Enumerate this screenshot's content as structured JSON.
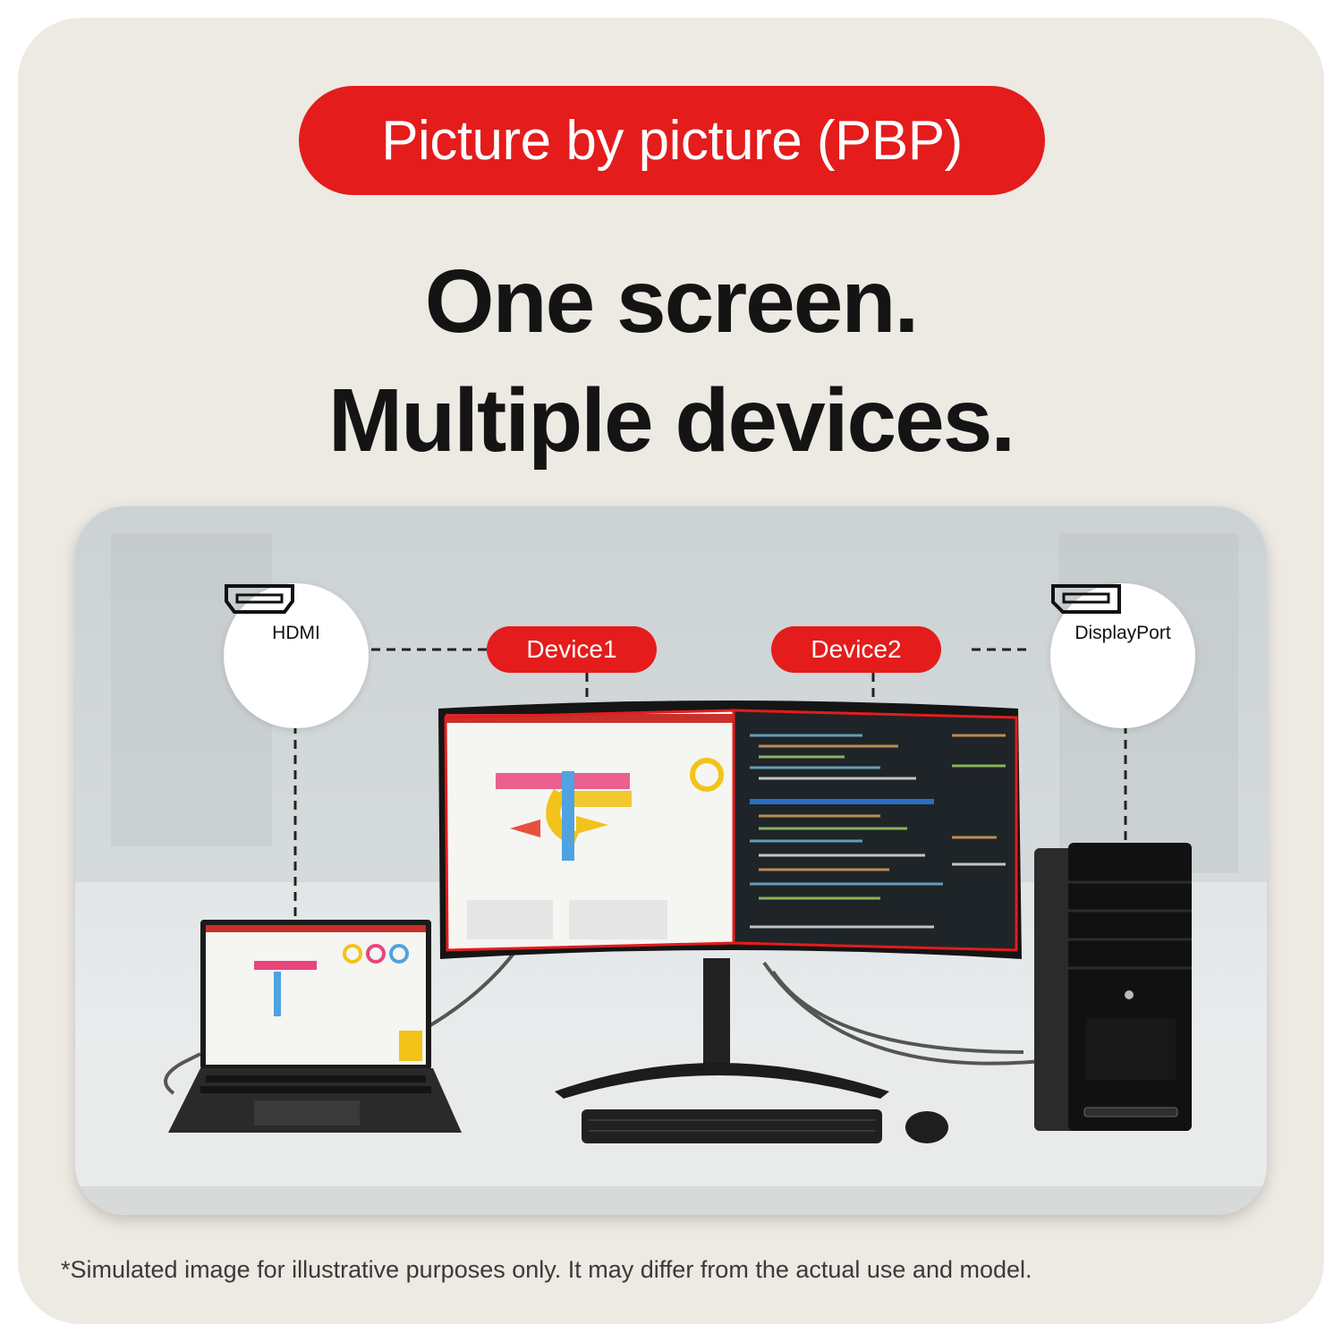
{
  "badge": {
    "text": "Picture by picture (PBP)"
  },
  "headline": {
    "line1": "One screen.",
    "line2": "Multiple devices."
  },
  "ports": {
    "left": {
      "label": "HDMI",
      "icon": "hdmi-port-icon"
    },
    "right": {
      "label": "DisplayPort",
      "icon": "displayport-icon"
    }
  },
  "devices": {
    "device1": "Device1",
    "device2": "Device2"
  },
  "disclaimer": "*Simulated image for illustrative purposes only. It may differ from the actual use and model.",
  "colors": {
    "accent": "#e41c1c",
    "background": "#ede9e3",
    "text": "#141414"
  }
}
